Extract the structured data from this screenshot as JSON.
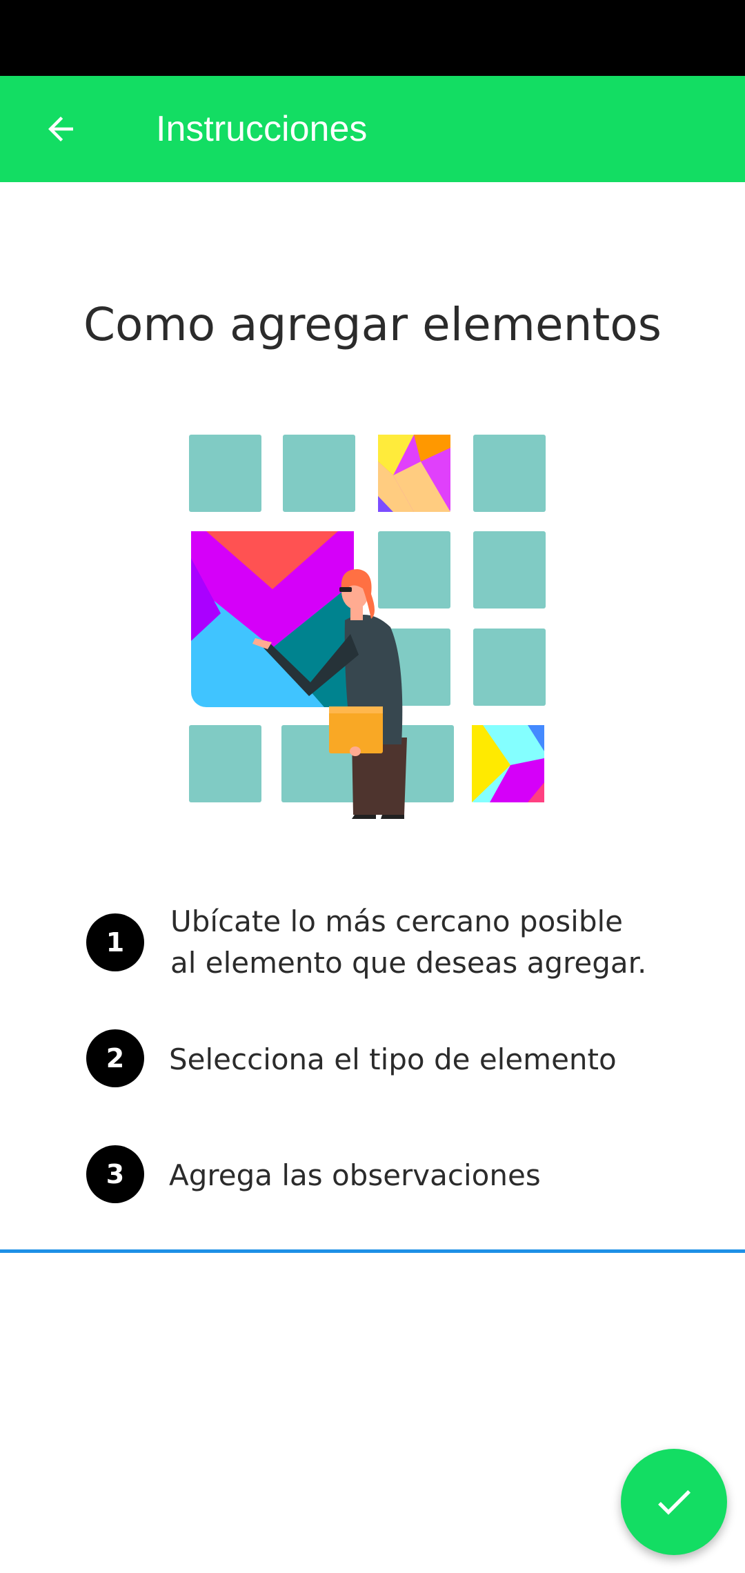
{
  "app_bar": {
    "title": "Instrucciones",
    "back_icon": "arrow-back-icon",
    "background_color": "#13dd63"
  },
  "main": {
    "heading": "Como agregar elementos",
    "steps": [
      {
        "number": "1",
        "line1": "Ubícate lo más cercano posible",
        "line2": "al elemento que deseas agregar."
      },
      {
        "number": "2",
        "line1": "Selecciona el tipo de elemento"
      },
      {
        "number": "3",
        "line1": "Agrega las observaciones"
      }
    ]
  },
  "fab": {
    "icon": "check-icon",
    "color": "#13dd63"
  },
  "colors": {
    "accent": "#13dd63",
    "divider": "#1e90e6"
  }
}
